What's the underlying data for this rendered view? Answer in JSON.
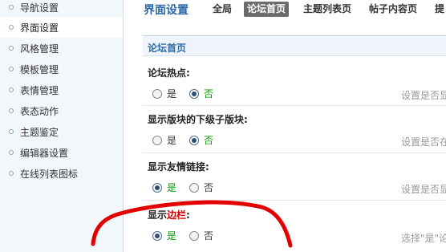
{
  "sidebar": {
    "items": [
      {
        "label": "导航设置",
        "active": false
      },
      {
        "label": "界面设置",
        "active": true
      },
      {
        "label": "风格管理",
        "active": false
      },
      {
        "label": "模板管理",
        "active": false
      },
      {
        "label": "表情管理",
        "active": false
      },
      {
        "label": "表态动作",
        "active": false
      },
      {
        "label": "主题鉴定",
        "active": false
      },
      {
        "label": "编辑器设置",
        "active": false
      },
      {
        "label": "在线列表图标",
        "active": false
      }
    ]
  },
  "header": {
    "title": "界面设置",
    "tabs": [
      {
        "label": "全局",
        "active": false
      },
      {
        "label": "论坛首页",
        "active": true
      },
      {
        "label": "主题列表页",
        "active": false
      },
      {
        "label": "帖子内容页",
        "active": false
      },
      {
        "label": "提",
        "active": false
      }
    ]
  },
  "section": {
    "title": "论坛首页"
  },
  "settings": [
    {
      "label": "论坛热点:",
      "label_pre": "",
      "label_hl": "",
      "label_post": "",
      "yes": "是",
      "no": "否",
      "selected": "no",
      "hint": "设置是否显"
    },
    {
      "label": "显示版块的下级子版块:",
      "label_pre": "",
      "label_hl": "",
      "label_post": "",
      "yes": "是",
      "no": "否",
      "selected": "no",
      "hint": "设置是否在"
    },
    {
      "label": "显示友情链接:",
      "label_pre": "",
      "label_hl": "",
      "label_post": "",
      "yes": "是",
      "no": "否",
      "selected": "yes",
      "hint": "设置是否显"
    },
    {
      "label": "",
      "label_pre": "显示",
      "label_hl": "边栏",
      "label_post": ":",
      "yes": "是",
      "no": "否",
      "selected": "yes",
      "hint": "选择\"是\"论"
    }
  ],
  "colors": {
    "accent": "#2e6aa8",
    "sidebar_bg": "#f2f7fc",
    "selected_option": "#0a9a0a",
    "highlight_text": "#cc0000",
    "annotation_stroke": "#e30000"
  }
}
